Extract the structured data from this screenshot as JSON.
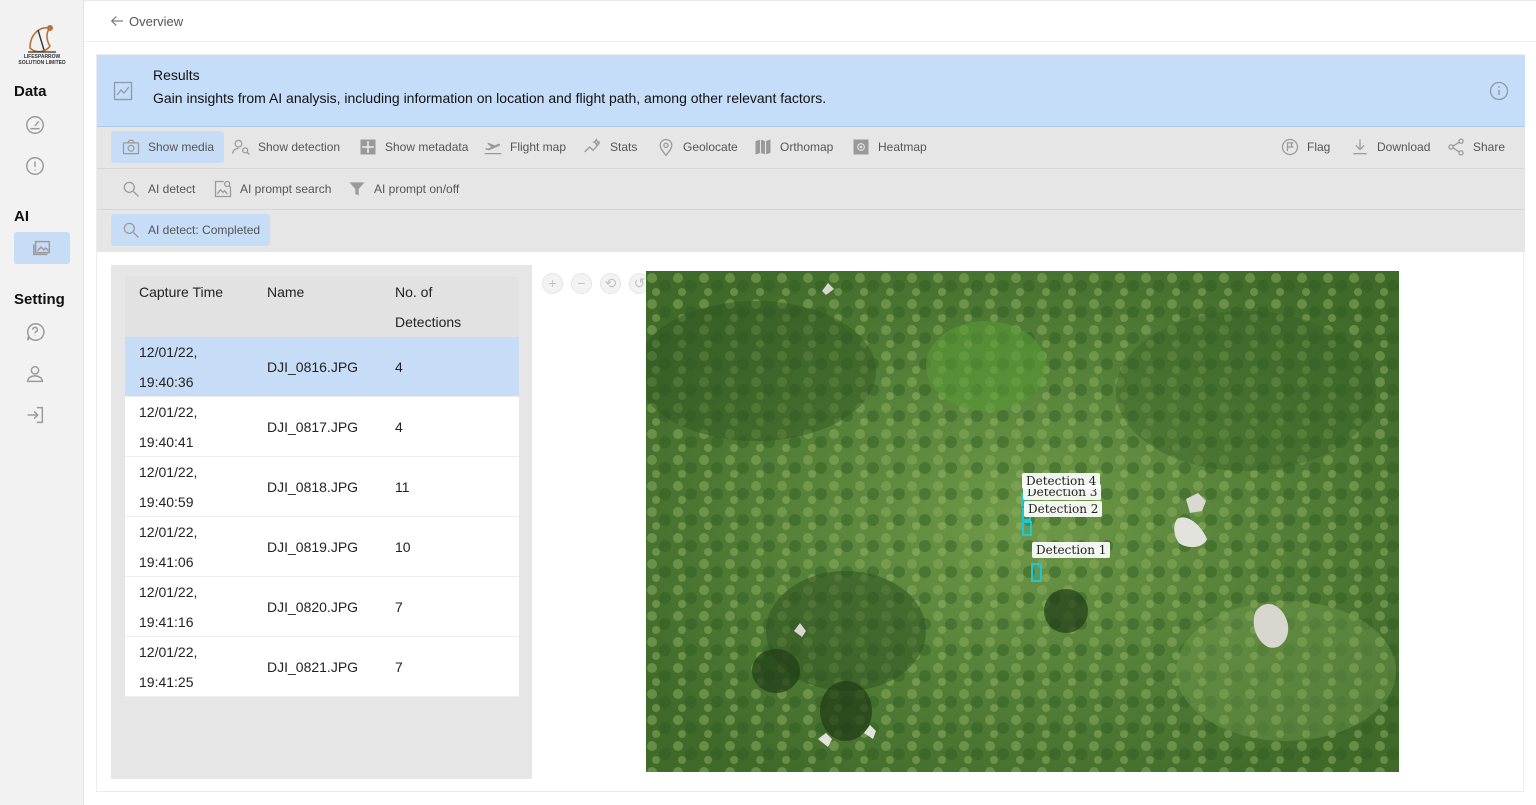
{
  "sidebar": {
    "logo_text": "LIFESPARROW SOLUTION LIMITED",
    "sections": {
      "data": "Data",
      "ai": "AI",
      "setting": "Setting"
    }
  },
  "topbar": {
    "back_label": "Overview"
  },
  "banner": {
    "title": "Results",
    "description": "Gain insights from AI analysis, including information on location and flight path, among other relevant factors."
  },
  "toolbar_main": {
    "show_media": "Show media",
    "show_detection": "Show detection",
    "show_metadata": "Show metadata",
    "flight_map": "Flight map",
    "stats": "Stats",
    "geolocate": "Geolocate",
    "orthomap": "Orthomap",
    "heatmap": "Heatmap",
    "flag": "Flag",
    "download": "Download",
    "share": "Share"
  },
  "toolbar_ai": {
    "ai_detect": "AI detect",
    "ai_prompt_search": "AI prompt search",
    "ai_prompt_toggle": "AI prompt on/off"
  },
  "status": {
    "ai_detect_status": "AI detect: Completed"
  },
  "table": {
    "headers": {
      "capture_time": "Capture Time",
      "name": "Name",
      "detections_line1": "No. of",
      "detections_line2": "Detections"
    },
    "rows": [
      {
        "date": "12/01/22,",
        "time": "19:40:36",
        "name": "DJI_0816.JPG",
        "detections": "4"
      },
      {
        "date": "12/01/22,",
        "time": "19:40:41",
        "name": "DJI_0817.JPG",
        "detections": "4"
      },
      {
        "date": "12/01/22,",
        "time": "19:40:59",
        "name": "DJI_0818.JPG",
        "detections": "11"
      },
      {
        "date": "12/01/22,",
        "time": "19:41:06",
        "name": "DJI_0819.JPG",
        "detections": "10"
      },
      {
        "date": "12/01/22,",
        "time": "19:41:16",
        "name": "DJI_0820.JPG",
        "detections": "7"
      },
      {
        "date": "12/01/22,",
        "time": "19:41:25",
        "name": "DJI_0821.JPG",
        "detections": "7"
      }
    ]
  },
  "viewer": {
    "zoom_in": "+",
    "zoom_out": "−",
    "detections": {
      "d4": "Detection 4",
      "d3": "Detection 3",
      "d2": "Detection 2",
      "d1": "Detection 1"
    }
  },
  "colors": {
    "accent": "#c7dcf6",
    "banner": "#c5ddf8",
    "toolbar": "#e6e6e6",
    "detection_box": "#1fc7d4"
  }
}
